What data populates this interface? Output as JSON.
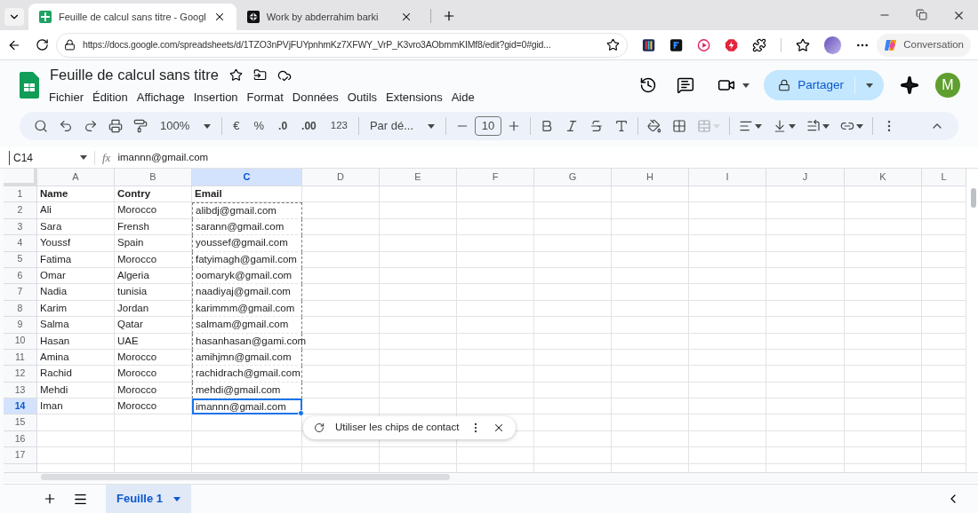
{
  "browser": {
    "tabs": [
      {
        "title": "Feuille de calcul sans titre - Googl",
        "selected": true
      },
      {
        "title": "Work by abderrahim barki",
        "selected": false
      }
    ],
    "url": "https://docs.google.com/spreadsheets/d/1TZO3nPVjFUYpnhmKz7XFWY_VrP_K3vro3AObmmKIMf8/edit?gid=0#gid...",
    "copilot": "Conversation"
  },
  "doc": {
    "title": "Feuille de calcul sans titre",
    "menu": [
      "Fichier",
      "Édition",
      "Affichage",
      "Insertion",
      "Format",
      "Données",
      "Outils",
      "Extensions",
      "Aide"
    ],
    "share": "Partager",
    "avatar": "M"
  },
  "toolbar": {
    "zoom": "100%",
    "currency": "€",
    "percent": "%",
    "decrease_decimals": ".0",
    "increase_decimals": ".00",
    "number_format": "123",
    "font": "Par dé...",
    "font_size": "10"
  },
  "formula_bar": {
    "cell": "C14",
    "fx": "fx",
    "value": "imannn@gmail.com"
  },
  "grid": {
    "columns": [
      {
        "label": "A",
        "selected": false,
        "copied": false
      },
      {
        "label": "B",
        "selected": false,
        "copied": false
      },
      {
        "label": "C",
        "selected": true,
        "copied": true
      },
      {
        "label": "D",
        "selected": false,
        "copied": false
      },
      {
        "label": "E",
        "selected": false,
        "copied": false
      },
      {
        "label": "F",
        "selected": false,
        "copied": false
      },
      {
        "label": "G",
        "selected": false,
        "copied": false
      },
      {
        "label": "H",
        "selected": false,
        "copied": false
      },
      {
        "label": "I",
        "selected": false,
        "copied": false
      },
      {
        "label": "J",
        "selected": false,
        "copied": false
      },
      {
        "label": "K",
        "selected": false,
        "copied": false
      },
      {
        "label": "L",
        "selected": false,
        "copied": false
      }
    ],
    "rows": [
      {
        "label": "1",
        "bold": true,
        "selected": false,
        "copied": false,
        "cells": [
          "Name",
          "Contry",
          "Email"
        ]
      },
      {
        "label": "2",
        "bold": false,
        "selected": false,
        "copied": true,
        "cells": [
          "Ali",
          "Morocco",
          "alibdj@gmail.com"
        ]
      },
      {
        "label": "3",
        "bold": false,
        "selected": false,
        "copied": true,
        "cells": [
          "Sara",
          "Frensh",
          "sarann@gmail.com"
        ]
      },
      {
        "label": "4",
        "bold": false,
        "selected": false,
        "copied": true,
        "cells": [
          "Youssf",
          "Spain",
          "youssef@gmail.com"
        ]
      },
      {
        "label": "5",
        "bold": false,
        "selected": false,
        "copied": true,
        "cells": [
          "Fatima",
          "Morocco",
          "fatyimagh@gamil.com"
        ]
      },
      {
        "label": "6",
        "bold": false,
        "selected": false,
        "copied": true,
        "cells": [
          "Omar",
          "Algeria",
          "oomaryk@gmail.com"
        ]
      },
      {
        "label": "7",
        "bold": false,
        "selected": false,
        "copied": true,
        "cells": [
          "Nadia",
          "tunisia",
          "naadiyaj@gmail.com"
        ]
      },
      {
        "label": "8",
        "bold": false,
        "selected": false,
        "copied": true,
        "cells": [
          "Karim",
          "Jordan",
          "karimmm@gmail.com"
        ]
      },
      {
        "label": "9",
        "bold": false,
        "selected": false,
        "copied": true,
        "cells": [
          "Salma",
          "Qatar",
          "salmam@gmail.com"
        ]
      },
      {
        "label": "10",
        "bold": false,
        "selected": false,
        "copied": true,
        "cells": [
          "Hasan",
          "UAE",
          "hasanhasan@gami.com"
        ]
      },
      {
        "label": "11",
        "bold": false,
        "selected": false,
        "copied": true,
        "cells": [
          "Amina",
          "Morocco",
          "amihjmn@gmail.com"
        ]
      },
      {
        "label": "12",
        "bold": false,
        "selected": false,
        "copied": true,
        "cells": [
          "Rachid",
          "Morocco",
          "rachidrach@gmail.com"
        ]
      },
      {
        "label": "13",
        "bold": false,
        "selected": false,
        "copied": true,
        "cells": [
          "Mehdi",
          "Morocco",
          "mehdi@gmail.com"
        ]
      },
      {
        "label": "14",
        "bold": false,
        "selected": true,
        "copied": true,
        "cells": [
          "Iman",
          "Morocco",
          "imannn@gmail.com"
        ]
      },
      {
        "label": "15",
        "selected": false,
        "copied": false
      },
      {
        "label": "16",
        "selected": false,
        "copied": false
      },
      {
        "label": "17",
        "selected": false,
        "copied": false
      }
    ]
  },
  "chip_prompt": "Utiliser les chips de contact",
  "sheets": [
    {
      "name": "Feuille 1",
      "selected": true
    }
  ]
}
